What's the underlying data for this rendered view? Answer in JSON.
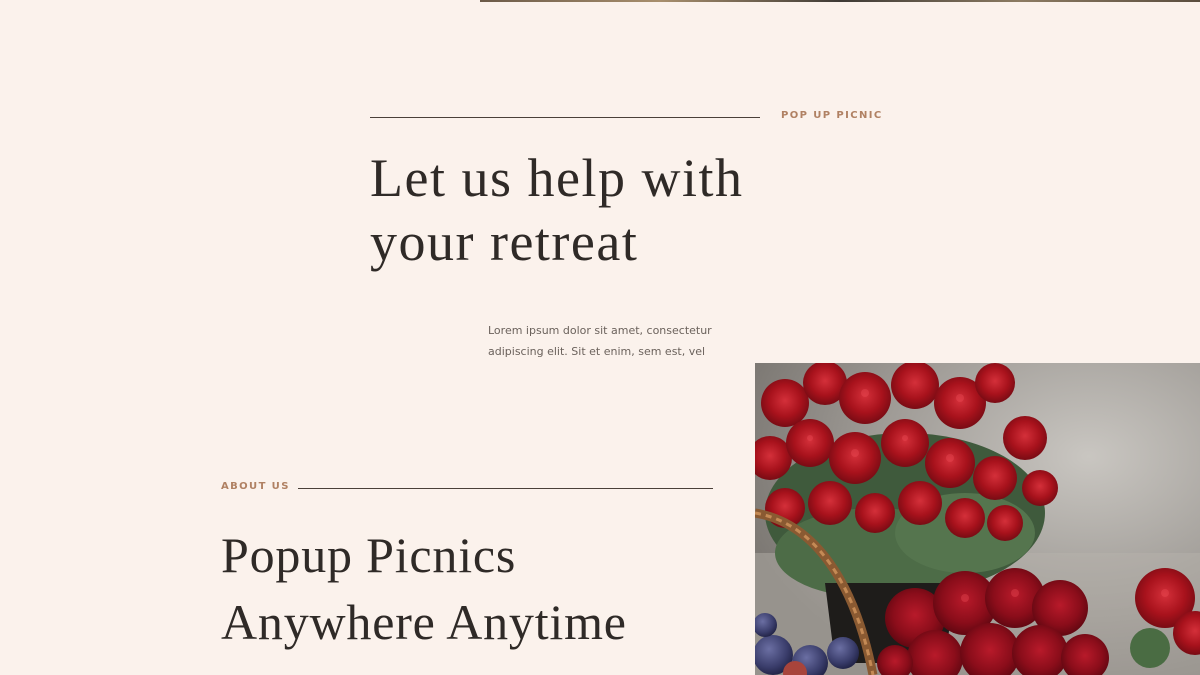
{
  "hero": {
    "eyebrow": "POP UP PICNIC",
    "heading_line1": "Let us help with",
    "heading_line2": "your retreat",
    "body_line1": "Lorem ipsum dolor sit amet, consectetur",
    "body_line2": "adipiscing elit. Sit et enim, sem est, vel"
  },
  "about": {
    "eyebrow": "ABOUT US",
    "heading_line1": "Popup Picnics",
    "heading_line2": "Anywhere Anytime"
  },
  "photo": {
    "subject": "red-chrysanthemums-with-basket"
  },
  "colors": {
    "background": "#fbf2ec",
    "accent": "#b08163",
    "heading": "#2f2a27",
    "body": "#6b625c",
    "rule": "#4a4039",
    "flower_red": "#b3121d"
  }
}
